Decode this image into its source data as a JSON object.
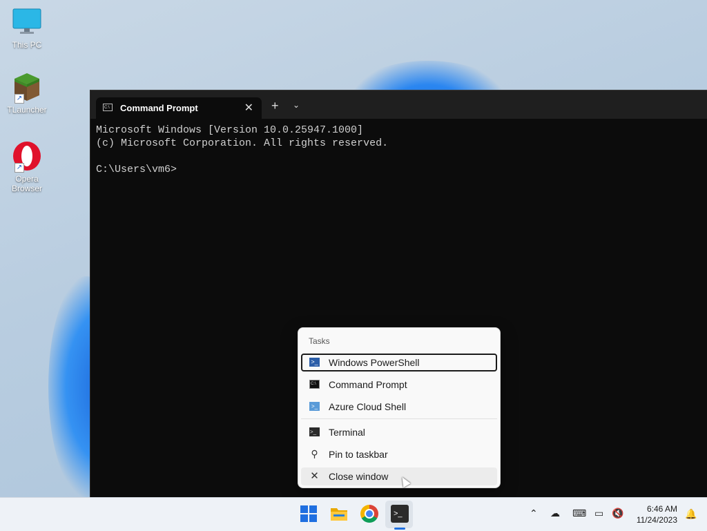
{
  "desktop": {
    "icons": [
      {
        "label": "This PC"
      },
      {
        "label": "TLauncher"
      },
      {
        "label": "Opera Browser"
      }
    ]
  },
  "terminal": {
    "tab_title": "Command Prompt",
    "new_tab": "+",
    "dropdown": "⌄",
    "close": "✕",
    "output": "Microsoft Windows [Version 10.0.25947.1000]\n(c) Microsoft Corporation. All rights reserved.\n\nC:\\Users\\vm6>"
  },
  "jump_list": {
    "heading": "Tasks",
    "tasks": [
      {
        "label": "Windows PowerShell",
        "icon": "powershell-icon"
      },
      {
        "label": "Command Prompt",
        "icon": "command-prompt-icon"
      },
      {
        "label": "Azure Cloud Shell",
        "icon": "azure-cloud-shell-icon"
      }
    ],
    "actions": [
      {
        "label": "Terminal",
        "icon": "terminal-icon"
      },
      {
        "label": "Pin to taskbar",
        "icon": "pin-icon"
      },
      {
        "label": "Close window",
        "icon": "close-icon"
      }
    ]
  },
  "taskbar": {
    "time": "6:46 AM",
    "date": "11/24/2023",
    "accent": "#1f6fe0"
  }
}
